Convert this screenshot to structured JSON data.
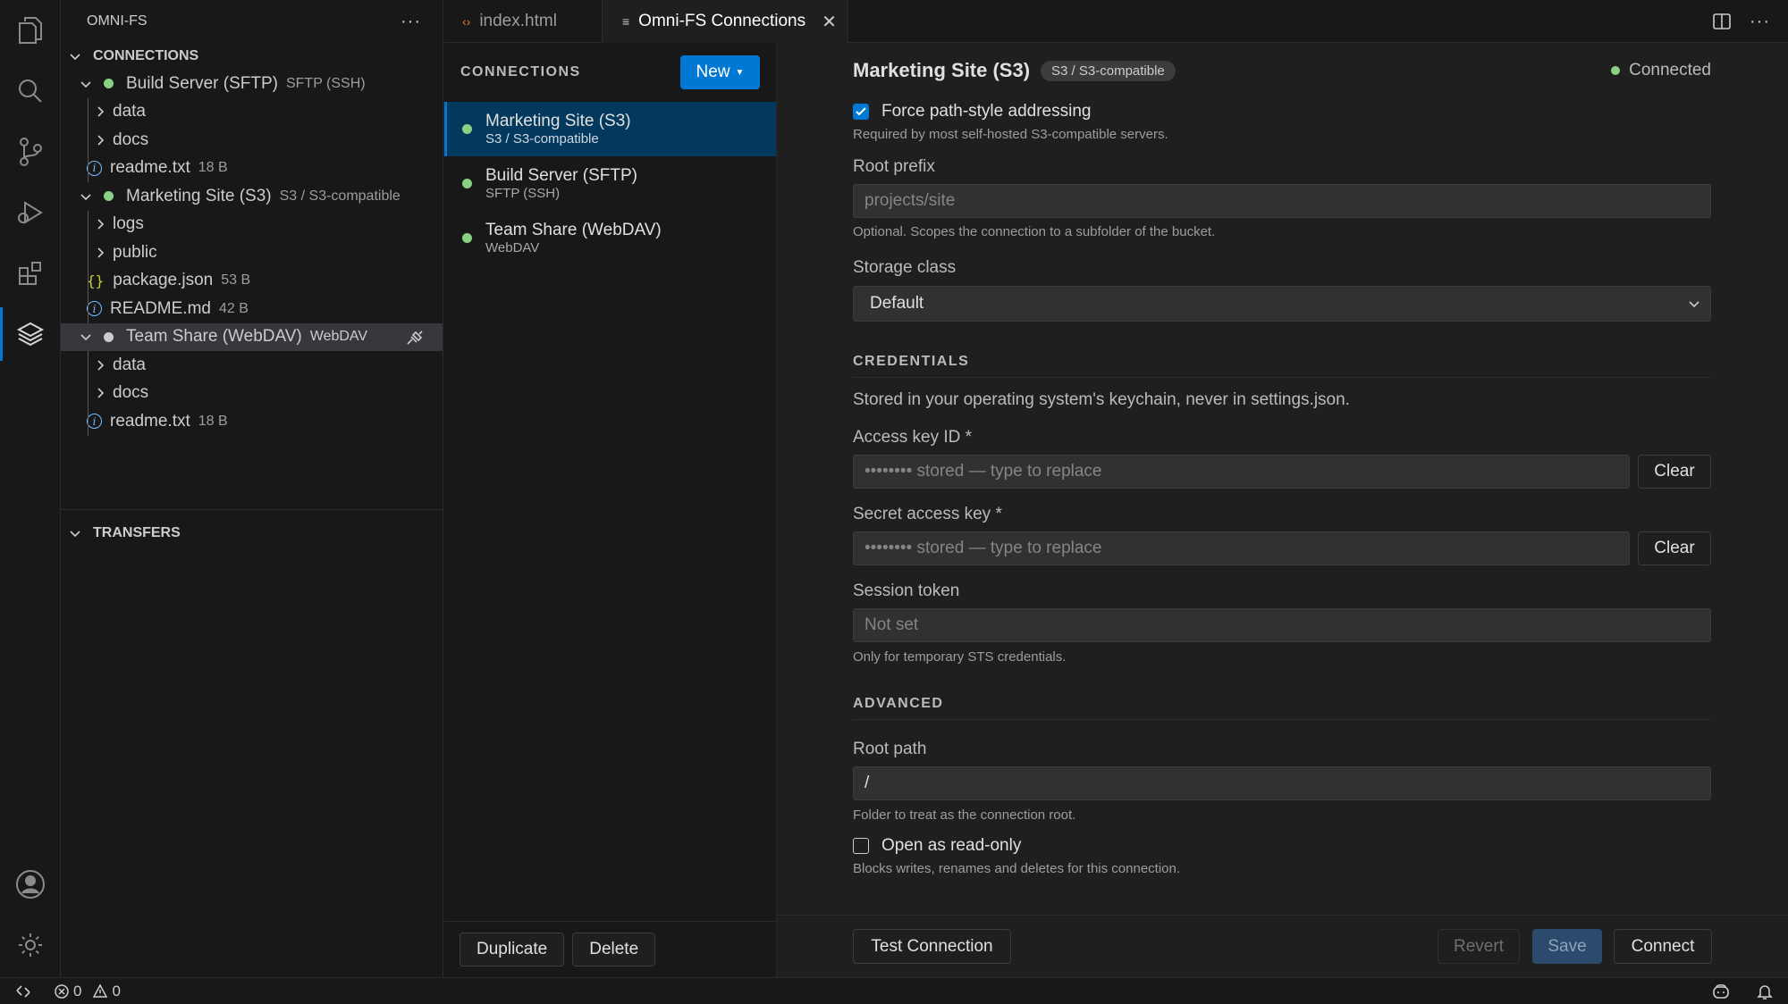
{
  "sidebar": {
    "title": "OMNI-FS",
    "connections_section": "CONNECTIONS",
    "transfers_section": "TRANSFERS",
    "tree": [
      {
        "label": "Build Server (SFTP)",
        "meta": "SFTP (SSH)"
      },
      {
        "label": "data"
      },
      {
        "label": "docs"
      },
      {
        "label": "readme.txt",
        "meta": "18 B"
      },
      {
        "label": "Marketing Site (S3)",
        "meta": "S3 / S3-compatible"
      },
      {
        "label": "logs"
      },
      {
        "label": "public"
      },
      {
        "label": "package.json",
        "meta": "53 B"
      },
      {
        "label": "README.md",
        "meta": "42 B"
      },
      {
        "label": "Team Share (WebDAV)",
        "meta": "WebDAV"
      },
      {
        "label": "data"
      },
      {
        "label": "docs"
      },
      {
        "label": "readme.txt",
        "meta": "18 B"
      }
    ]
  },
  "tabs": [
    {
      "label": "index.html"
    },
    {
      "label": "Omni-FS Connections"
    }
  ],
  "connections": {
    "title": "CONNECTIONS",
    "new_label": "New",
    "items": [
      {
        "name": "Marketing Site (S3)",
        "type": "S3 / S3-compatible"
      },
      {
        "name": "Build Server (SFTP)",
        "type": "SFTP (SSH)"
      },
      {
        "name": "Team Share (WebDAV)",
        "type": "WebDAV"
      }
    ],
    "duplicate_label": "Duplicate",
    "delete_label": "Delete"
  },
  "form": {
    "title": "Marketing Site (S3)",
    "badge": "S3 / S3-compatible",
    "status": "Connected",
    "force_path": {
      "label": "Force path-style addressing",
      "checked": true,
      "hint": "Required by most self-hosted S3-compatible servers."
    },
    "root_prefix": {
      "label": "Root prefix",
      "placeholder": "projects/site",
      "hint": "Optional. Scopes the connection to a subfolder of the bucket."
    },
    "storage_class": {
      "label": "Storage class",
      "value": "Default"
    },
    "credentials": {
      "title": "CREDENTIALS",
      "description": "Stored in your operating system's keychain, never in settings.json.",
      "access_key": {
        "label": "Access key ID *",
        "placeholder": "•••••••• stored — type to replace",
        "clear": "Clear"
      },
      "secret_key": {
        "label": "Secret access key *",
        "placeholder": "•••••••• stored — type to replace",
        "clear": "Clear"
      },
      "session_token": {
        "label": "Session token",
        "placeholder": "Not set",
        "hint": "Only for temporary STS credentials."
      }
    },
    "advanced": {
      "title": "ADVANCED",
      "root_path": {
        "label": "Root path",
        "value": "/",
        "hint": "Folder to treat as the connection root."
      },
      "read_only": {
        "label": "Open as read-only",
        "checked": false,
        "hint": "Blocks writes, renames and deletes for this connection."
      }
    },
    "footer": {
      "test": "Test Connection",
      "revert": "Revert",
      "save": "Save",
      "connect": "Connect"
    }
  },
  "statusbar": {
    "errors": "0",
    "warnings": "0"
  },
  "colors": {
    "accent": "#0078d4",
    "connected": "#89d185",
    "selected_row": "#04395e"
  }
}
